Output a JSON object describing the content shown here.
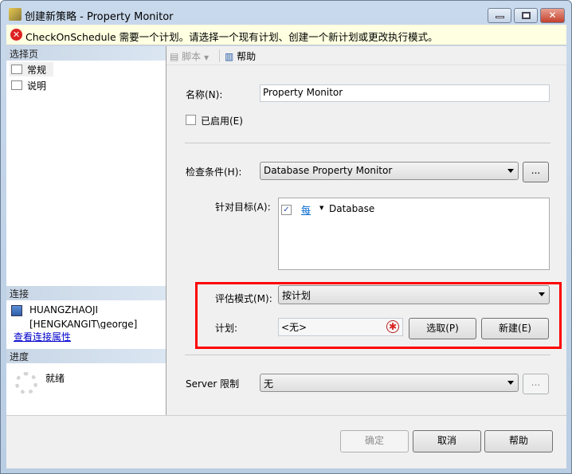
{
  "window": {
    "title": "创建新策略 - Property Monitor"
  },
  "warning": {
    "text": "CheckOnSchedule 需要一个计划。请选择一个现有计划、创建一个新计划或更改执行模式。"
  },
  "left": {
    "select_page_header": "选择页",
    "pages": [
      {
        "label": "常规"
      },
      {
        "label": "说明"
      }
    ],
    "connection_header": "连接",
    "server": "HUANGZHAOJI",
    "user": "[HENGKANGIT\\george]",
    "view_connection_link": "查看连接属性",
    "progress_header": "进度",
    "progress_status": "就绪"
  },
  "toolbar": {
    "script_label": "脚本",
    "help_label": "帮助"
  },
  "form": {
    "name_label": "名称(N):",
    "name_value": "Property Monitor",
    "enabled_label": "已启用(E)",
    "enabled_checked": false,
    "condition_label": "检查条件(H):",
    "condition_value": "Database Property Monitor",
    "ellipsis": "...",
    "targets_label": "针对目标(A):",
    "target_every": "每",
    "target_type": "Database",
    "target_checked": true,
    "eval_mode_label": "评估模式(M):",
    "eval_mode_value": "按计划",
    "schedule_label": "计划:",
    "schedule_value": "<无>",
    "pick_button": "选取(P)",
    "new_button": "新建(E)",
    "server_limit_label": "Server 限制",
    "server_limit_value": "无",
    "server_limit_ellipsis": "..."
  },
  "buttons": {
    "ok": "确定",
    "cancel": "取消",
    "help": "帮助"
  },
  "colors": {
    "highlight_border": "#ff0000",
    "warning_bg": "#ffffe1",
    "link": "#0000cc"
  }
}
